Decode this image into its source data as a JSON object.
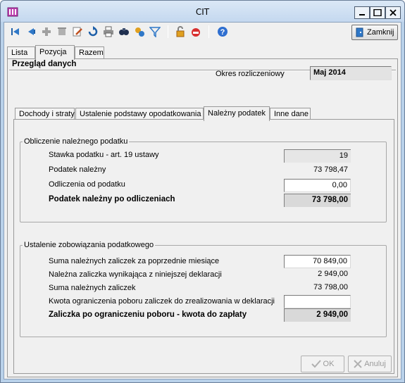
{
  "window": {
    "title": "CIT"
  },
  "toolbar": {
    "close_label": "Zamknij"
  },
  "tabs_top": [
    {
      "label": "Lista"
    },
    {
      "label": "Pozycja"
    },
    {
      "label": "Razem"
    }
  ],
  "panel": {
    "title": "Przegląd danych",
    "okres_label": "Okres rozliczeniowy",
    "okres_value": "Maj 2014"
  },
  "tabs_inner": [
    {
      "label": "Dochody i straty"
    },
    {
      "label": "Ustalenie podstawy opodatkowania"
    },
    {
      "label": "Należny podatek"
    },
    {
      "label": "Inne dane"
    }
  ],
  "group1": {
    "title": "Obliczenie należnego podatku",
    "rows": [
      {
        "label": "Stawka podatku - art. 19 ustawy",
        "value": "19"
      },
      {
        "label": "Podatek należny",
        "value": "73 798,47"
      },
      {
        "label": "Odliczenia od podatku",
        "value": "0,00"
      },
      {
        "label": "Podatek należny po odliczeniach",
        "value": "73 798,00"
      }
    ]
  },
  "group2": {
    "title": "Ustalenie zobowiązania podatkowego",
    "rows": [
      {
        "label": "Suma należnych zaliczek za poprzednie miesiące",
        "value": "70 849,00"
      },
      {
        "label": "Należna zaliczka wynikająca z niniejszej deklaracji",
        "value": "2 949,00"
      },
      {
        "label": "Suma należnych zaliczek",
        "value": "73 798,00"
      },
      {
        "label": "Kwota ograniczenia poboru zaliczek do zrealizowania w deklaracji",
        "value": ""
      },
      {
        "label": "Zaliczka po ograniczeniu poboru - kwota do zapłaty",
        "value": "2 949,00"
      }
    ]
  },
  "buttons": {
    "ok": "OK",
    "cancel": "Anuluj"
  }
}
